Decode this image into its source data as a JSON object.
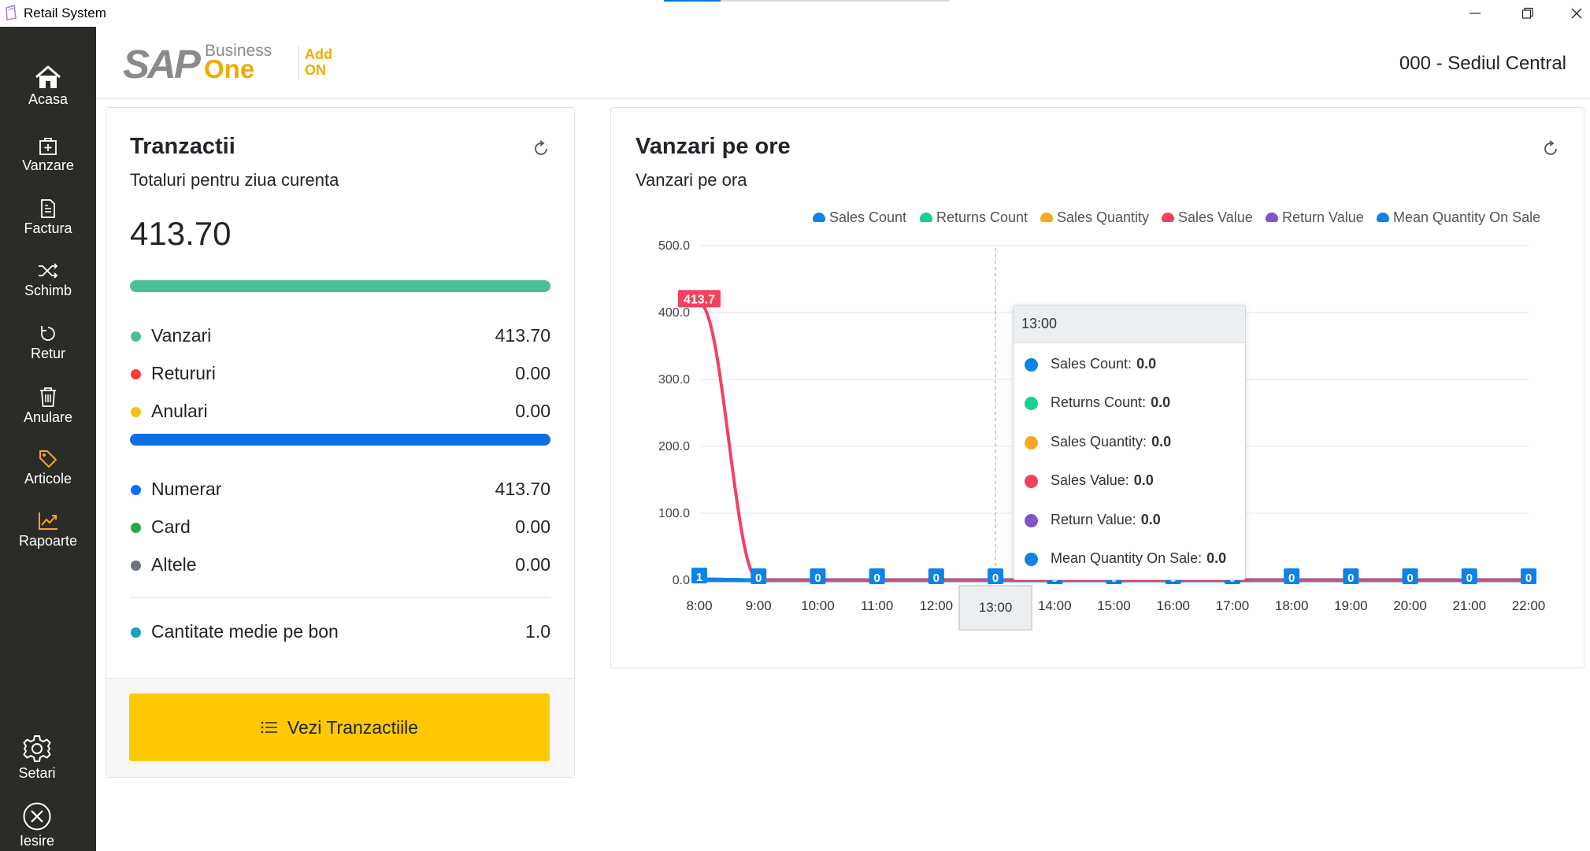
{
  "window": {
    "title": "Retail System"
  },
  "sidebar": {
    "items": [
      {
        "label": "Acasa",
        "icon": "home-icon"
      },
      {
        "label": "Vanzare",
        "icon": "shopping-bag-icon"
      },
      {
        "label": "Factura",
        "icon": "document-icon"
      },
      {
        "label": "Schimb",
        "icon": "shuffle-icon"
      },
      {
        "label": "Retur",
        "icon": "undo-icon"
      },
      {
        "label": "Anulare",
        "icon": "trash-icon"
      },
      {
        "label": "Articole",
        "icon": "tag-icon"
      },
      {
        "label": "Rapoarte",
        "icon": "chart-line-icon"
      }
    ],
    "bottom": [
      {
        "label": "Setari",
        "icon": "gear-icon"
      },
      {
        "label": "Iesire",
        "icon": "close-circle-icon"
      }
    ],
    "accent_color": "#f5a623"
  },
  "header": {
    "logo": {
      "sap": "SAP",
      "business": "Business",
      "one": "One",
      "addon_line1": "Add",
      "addon_line2": "ON"
    },
    "branch": "000 - Sediul Central"
  },
  "transactions": {
    "title": "Tranzactii",
    "subtitle": "Totaluri pentru ziua curenta",
    "total": "413.70",
    "rows_types": [
      {
        "label": "Vanzari",
        "value": "413.70",
        "color": "#4bbf9a"
      },
      {
        "label": "Retururi",
        "value": "0.00",
        "color": "#f0403c"
      },
      {
        "label": "Anulari",
        "value": "0.00",
        "color": "#f5c012"
      }
    ],
    "rows_payment": [
      {
        "label": "Numerar",
        "value": "413.70",
        "color": "#0d6efd"
      },
      {
        "label": "Card",
        "value": "0.00",
        "color": "#28a745"
      },
      {
        "label": "Altele",
        "value": "0.00",
        "color": "#6c757d"
      }
    ],
    "avg_row": {
      "label": "Cantitate medie pe bon",
      "value": "1.0",
      "color": "#17a2b8"
    },
    "bar_colors": {
      "types": "#4bbf9a",
      "payment": "#0b6ee5"
    },
    "button_label": "Vezi Tranzactiile"
  },
  "sales_chart": {
    "title": "Vanzari pe ore",
    "subtitle": "Vanzari pe ora",
    "tooltip": {
      "header": "13:00",
      "items": [
        {
          "label": "Sales Count:",
          "value": "0.0",
          "color": "#0b84e8"
        },
        {
          "label": "Returns Count:",
          "value": "0.0",
          "color": "#14d38c"
        },
        {
          "label": "Sales Quantity:",
          "value": "0.0",
          "color": "#f8a81e"
        },
        {
          "label": "Sales Value:",
          "value": "0.0",
          "color": "#f2425f"
        },
        {
          "label": "Return Value:",
          "value": "0.0",
          "color": "#7d56c9"
        },
        {
          "label": "Mean Quantity On Sale:",
          "value": "0.0",
          "color": "#0b84e8"
        }
      ]
    },
    "hover_category": "13:00"
  },
  "chart_data": {
    "type": "line",
    "title": "",
    "categories": [
      "8:00",
      "9:00",
      "10:00",
      "11:00",
      "12:00",
      "13:00",
      "14:00",
      "15:00",
      "16:00",
      "17:00",
      "18:00",
      "19:00",
      "20:00",
      "21:00",
      "22:00"
    ],
    "ylim": [
      0,
      500
    ],
    "yticks": [
      "0.0",
      "100.0",
      "200.0",
      "300.0",
      "400.0",
      "500.0"
    ],
    "yticks_values": [
      0,
      100,
      200,
      300,
      400,
      500
    ],
    "grid": true,
    "legend_position": "top-right",
    "series": [
      {
        "name": "Sales Count",
        "color": "#0b84e8",
        "values": [
          1,
          0,
          0,
          0,
          0,
          0,
          0,
          0,
          0,
          0,
          0,
          0,
          0,
          0,
          0
        ],
        "labels": [
          "1",
          "0",
          "0",
          "0",
          "0",
          "0",
          "0",
          "0",
          "0",
          "0",
          "0",
          "0",
          "0",
          "0",
          "0"
        ]
      },
      {
        "name": "Returns Count",
        "color": "#14d38c",
        "values": [
          0,
          0,
          0,
          0,
          0,
          0,
          0,
          0,
          0,
          0,
          0,
          0,
          0,
          0,
          0
        ]
      },
      {
        "name": "Sales Quantity",
        "color": "#f8a81e",
        "values": [
          0,
          0,
          0,
          0,
          0,
          0,
          0,
          0,
          0,
          0,
          0,
          0,
          0,
          0,
          0
        ]
      },
      {
        "name": "Sales Value",
        "color": "#f2425f",
        "values": [
          413.7,
          0,
          0,
          0,
          0,
          0,
          0,
          0,
          0,
          0,
          0,
          0,
          0,
          0,
          0
        ],
        "labels": [
          "413.7"
        ]
      },
      {
        "name": "Return Value",
        "color": "#7d56c9",
        "values": [
          0,
          0,
          0,
          0,
          0,
          0,
          0,
          0,
          0,
          0,
          0,
          0,
          0,
          0,
          0
        ]
      },
      {
        "name": "Mean Quantity On Sale",
        "color": "#0b84e8",
        "values": [
          1,
          0,
          0,
          0,
          0,
          0,
          0,
          0,
          0,
          0,
          0,
          0,
          0,
          0,
          0
        ]
      }
    ]
  }
}
